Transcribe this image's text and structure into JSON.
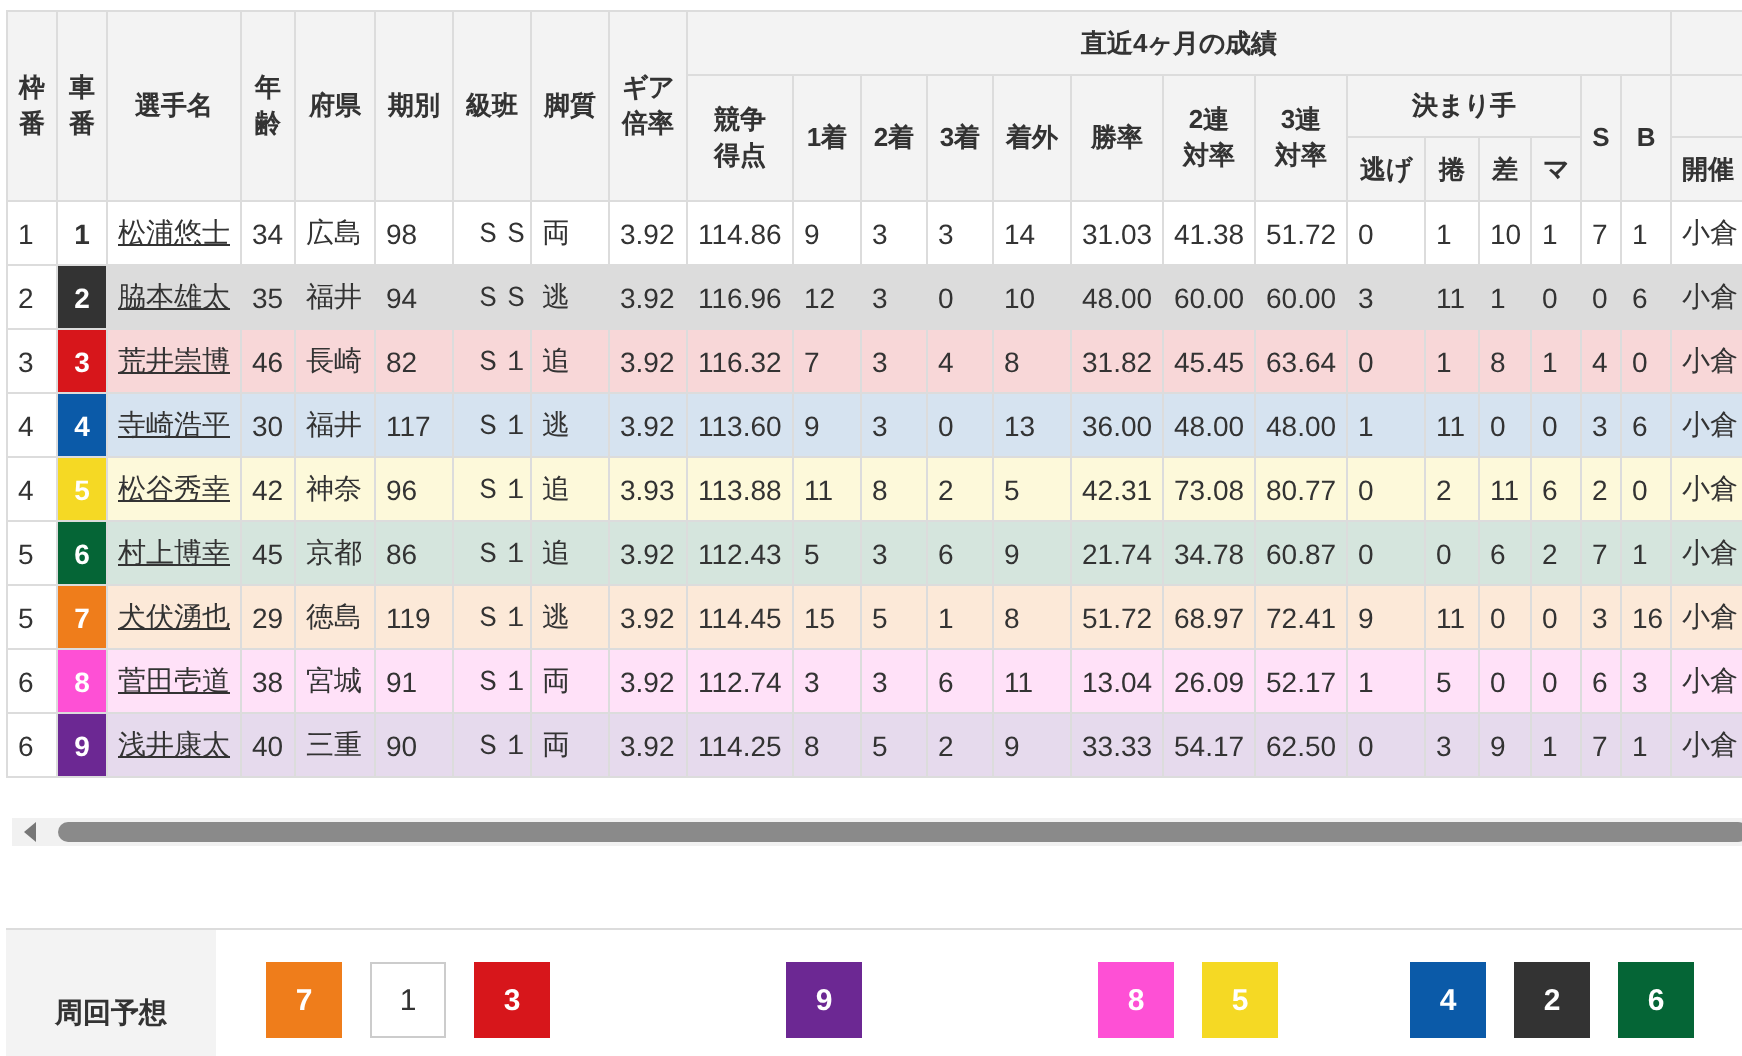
{
  "table": {
    "header": {
      "frame": "枠番",
      "car": "車番",
      "name": "選手名",
      "age": "年齢",
      "pref": "府県",
      "term": "期別",
      "class": "級班",
      "style": "脚質",
      "gear": "ギア倍率",
      "group": "直近4ヶ月の成績",
      "score": "競争得点",
      "first": "1着",
      "second": "2着",
      "third": "3着",
      "out": "着外",
      "win_rate": "勝率",
      "top2": "2連対率",
      "top3": "3連対率",
      "kimarite": "決まり手",
      "nige": "逃げ",
      "makuri": "捲",
      "sashi": "差",
      "ma": "マ",
      "s": "S",
      "b": "B",
      "venue": "開催"
    },
    "rows": [
      {
        "frame": "1",
        "car": "1",
        "color": "#ffffff",
        "name": "松浦悠士",
        "stats": [
          "34",
          "広島",
          "98",
          "ＳＳ",
          "両",
          "3.92",
          "114.86",
          "9",
          "3",
          "3",
          "14",
          "31.03",
          "41.38",
          "51.72",
          "0",
          "1",
          "10",
          "1",
          "7",
          "1",
          "小倉"
        ]
      },
      {
        "frame": "2",
        "car": "2",
        "color": "#333333",
        "name": "脇本雄太",
        "stats": [
          "35",
          "福井",
          "94",
          "ＳＳ",
          "逃",
          "3.92",
          "116.96",
          "12",
          "3",
          "0",
          "10",
          "48.00",
          "60.00",
          "60.00",
          "3",
          "11",
          "1",
          "0",
          "0",
          "6",
          "小倉"
        ]
      },
      {
        "frame": "3",
        "car": "3",
        "color": "#d7161b",
        "name": "荒井崇博",
        "stats": [
          "46",
          "長崎",
          "82",
          "Ｓ１",
          "追",
          "3.92",
          "116.32",
          "7",
          "3",
          "4",
          "8",
          "31.82",
          "45.45",
          "63.64",
          "0",
          "1",
          "8",
          "1",
          "4",
          "0",
          "小倉"
        ]
      },
      {
        "frame": "4",
        "car": "4",
        "color": "#0b5aa8",
        "name": "寺崎浩平",
        "stats": [
          "30",
          "福井",
          "117",
          "Ｓ１",
          "逃",
          "3.92",
          "113.60",
          "9",
          "3",
          "0",
          "13",
          "36.00",
          "48.00",
          "48.00",
          "1",
          "11",
          "0",
          "0",
          "3",
          "6",
          "小倉"
        ]
      },
      {
        "frame": "4",
        "car": "5",
        "color": "#f5d924",
        "name": "松谷秀幸",
        "stats": [
          "42",
          "神奈",
          "96",
          "Ｓ１",
          "追",
          "3.93",
          "113.88",
          "11",
          "8",
          "2",
          "5",
          "42.31",
          "73.08",
          "80.77",
          "0",
          "2",
          "11",
          "6",
          "2",
          "0",
          "小倉"
        ]
      },
      {
        "frame": "5",
        "car": "6",
        "color": "#056536",
        "name": "村上博幸",
        "stats": [
          "45",
          "京都",
          "86",
          "Ｓ１",
          "追",
          "3.92",
          "112.43",
          "5",
          "3",
          "6",
          "9",
          "21.74",
          "34.78",
          "60.87",
          "0",
          "0",
          "6",
          "2",
          "7",
          "1",
          "小倉"
        ]
      },
      {
        "frame": "5",
        "car": "7",
        "color": "#ef7d1b",
        "name": "犬伏湧也",
        "stats": [
          "29",
          "徳島",
          "119",
          "Ｓ１",
          "逃",
          "3.92",
          "114.45",
          "15",
          "5",
          "1",
          "8",
          "51.72",
          "68.97",
          "72.41",
          "9",
          "11",
          "0",
          "0",
          "3",
          "16",
          "小倉"
        ]
      },
      {
        "frame": "6",
        "car": "8",
        "color": "#fe50d5",
        "name": "菅田壱道",
        "stats": [
          "38",
          "宮城",
          "91",
          "Ｓ１",
          "両",
          "3.92",
          "112.74",
          "3",
          "3",
          "6",
          "11",
          "13.04",
          "26.09",
          "52.17",
          "1",
          "5",
          "0",
          "0",
          "6",
          "3",
          "小倉"
        ]
      },
      {
        "frame": "6",
        "car": "9",
        "color": "#6c2893",
        "name": "浅井康太",
        "stats": [
          "40",
          "三重",
          "90",
          "Ｓ１",
          "両",
          "3.92",
          "114.25",
          "8",
          "5",
          "2",
          "9",
          "33.33",
          "54.17",
          "62.50",
          "0",
          "3",
          "9",
          "1",
          "7",
          "1",
          "小倉"
        ]
      }
    ]
  },
  "lap_prediction": {
    "label": "周回予想",
    "slots": [
      {
        "kind": "car",
        "number": "7",
        "color": "#ef7d1b"
      },
      {
        "kind": "car",
        "number": "1",
        "color": "#ffffff"
      },
      {
        "kind": "car",
        "number": "3",
        "color": "#d7161b"
      },
      {
        "kind": "blank"
      },
      {
        "kind": "blank"
      },
      {
        "kind": "car",
        "number": "9",
        "color": "#6c2893"
      },
      {
        "kind": "blank"
      },
      {
        "kind": "blank"
      },
      {
        "kind": "car",
        "number": "8",
        "color": "#fe50d5"
      },
      {
        "kind": "car",
        "number": "5",
        "color": "#f5d924"
      },
      {
        "kind": "blank"
      },
      {
        "kind": "car",
        "number": "4",
        "color": "#0b5aa8"
      },
      {
        "kind": "car",
        "number": "2",
        "color": "#333333"
      },
      {
        "kind": "car",
        "number": "6",
        "color": "#056536"
      }
    ]
  }
}
